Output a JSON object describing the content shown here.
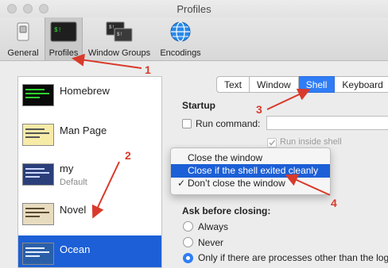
{
  "window": {
    "title": "Profiles"
  },
  "toolbar": {
    "items": [
      {
        "label": "General"
      },
      {
        "label": "Profiles"
      },
      {
        "label": "Window Groups"
      },
      {
        "label": "Encodings"
      }
    ]
  },
  "profiles": [
    {
      "name": "Homebrew",
      "subtitle": ""
    },
    {
      "name": "Man Page",
      "subtitle": ""
    },
    {
      "name": "my",
      "subtitle": "Default"
    },
    {
      "name": "Novel",
      "subtitle": ""
    },
    {
      "name": "Ocean",
      "subtitle": ""
    }
  ],
  "tabs": [
    "Text",
    "Window",
    "Shell",
    "Keyboard"
  ],
  "shell": {
    "startup_heading": "Startup",
    "run_command_label": "Run command:",
    "run_inside_shell_label": "Run inside shell",
    "menu_items": [
      {
        "label": "Close the window",
        "checked": false
      },
      {
        "label": "Close if the shell exited cleanly",
        "checked": false
      },
      {
        "label": "Don’t close the window",
        "checked": true
      }
    ],
    "check_mark": "✓",
    "ask_before_closing_heading": "Ask before closing:",
    "radio_options": [
      {
        "label": "Always"
      },
      {
        "label": "Never"
      },
      {
        "label": "Only if there are processes other than the log"
      }
    ]
  },
  "annotations": [
    "1",
    "2",
    "3",
    "4"
  ],
  "colors": {
    "accent": "#1c5fd6",
    "annotation": "#d93a2b"
  }
}
